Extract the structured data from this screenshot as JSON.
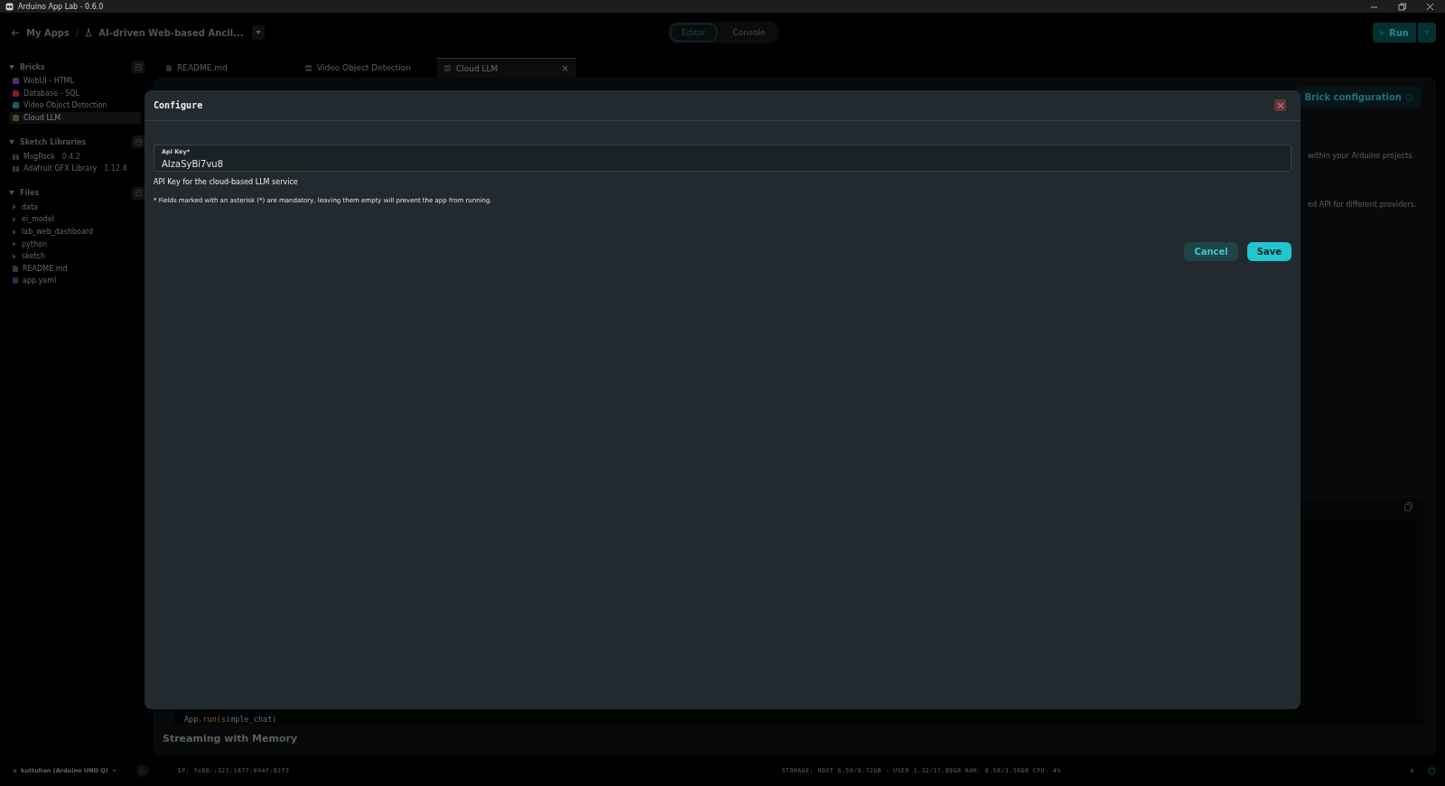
{
  "window": {
    "title": "Arduino App Lab - 0.6.0"
  },
  "header": {
    "back": "My Apps",
    "separator": "/",
    "app_name": "AI-driven Web-based Ancil...",
    "run": "Run",
    "modes": [
      {
        "label": "Editor",
        "selected": true
      },
      {
        "label": "Console",
        "selected": false
      }
    ]
  },
  "sidebar": {
    "sections": [
      {
        "title": "Bricks",
        "expanded": true,
        "items": [
          {
            "kind": "brick",
            "label": "WebUI - HTML",
            "color": "#5a2a78",
            "selected": false
          },
          {
            "kind": "brick",
            "label": "Database - SQL",
            "color": "#7a1f3a",
            "selected": false
          },
          {
            "kind": "brick",
            "label": "Video Object Detection",
            "color": "#1f5a6a",
            "selected": false
          },
          {
            "kind": "brick",
            "label": "Cloud LLM",
            "color": "#4a4a1e",
            "selected": true
          }
        ]
      },
      {
        "title": "Sketch Libraries",
        "expanded": true,
        "items": [
          {
            "kind": "library",
            "label": "MsgPack",
            "version": "0.4.2",
            "selected": false
          },
          {
            "kind": "library",
            "label": "Adafruit GFX Library",
            "version": "1.12.4",
            "selected": false
          }
        ]
      },
      {
        "title": "Files",
        "expanded": true,
        "items": [
          {
            "kind": "folder",
            "label": "data",
            "expanded": false,
            "selected": false
          },
          {
            "kind": "folder",
            "label": "ei_model",
            "expanded": false,
            "selected": false
          },
          {
            "kind": "folder",
            "label": "lab_web_dashboard",
            "expanded": false,
            "selected": false
          },
          {
            "kind": "folder",
            "label": "python",
            "expanded": false,
            "selected": false
          },
          {
            "kind": "folder",
            "label": "sketch",
            "expanded": false,
            "selected": false
          },
          {
            "kind": "markdown",
            "label": "README.md",
            "selected": false
          },
          {
            "kind": "yaml",
            "label": "app.yaml",
            "selected": false
          }
        ]
      }
    ]
  },
  "tabs": [
    {
      "label": "README.md",
      "kind": "doc",
      "selected": false
    },
    {
      "label": "Video Object Detection",
      "kind": "brick",
      "selected": false
    },
    {
      "label": "Cloud LLM",
      "kind": "brick",
      "selected": true,
      "close": "×"
    }
  ],
  "editor": {
    "config_button": "Brick configuration",
    "text_fragments": [
      "within your Arduino projects.",
      "ed API for different providers."
    ],
    "code": [
      {
        "text": "App.",
        "kind": "plain"
      },
      {
        "text": "run",
        "kind": "call"
      },
      {
        "text": "(simple_chat)",
        "kind": "plain"
      }
    ],
    "heading": "Streaming with Memory"
  },
  "dialog": {
    "title": "Configure",
    "field": {
      "label": "Api Key*",
      "value": "AIzaSyBi7vu8"
    },
    "help": "API Key for the cloud-based LLM service",
    "note": "* Fields marked with an asterisk (*) are mandatory, leaving them empty will prevent the app from running.",
    "buttons": [
      {
        "label": "Cancel",
        "kind": "secondary"
      },
      {
        "label": "Save",
        "kind": "primary"
      }
    ]
  },
  "status_bar": {
    "board": "kuttuhan (Arduino UNO Q)",
    "ip": "IP: fe80::321:1877:694f:03f3",
    "stats": "STORAGE: ROOT 6.59/9.72GB - USER 1.32/17.89GB  RAM: 0.58/3.58GB  CPU: 4%"
  }
}
